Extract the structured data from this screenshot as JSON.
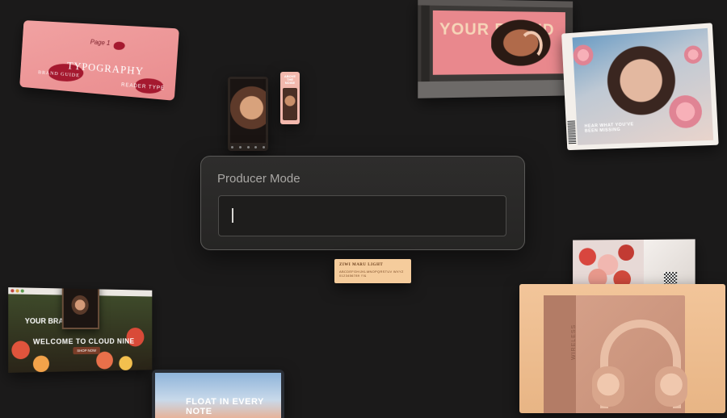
{
  "producer": {
    "title": "Producer Mode",
    "input_value": "",
    "input_placeholder": ""
  },
  "mockups": {
    "brand_guide": {
      "page_label": "Page 1",
      "typography": "TYPOGRAPHY",
      "brand_guide": "BRAND GUIDE",
      "reader": "READER TYPE"
    },
    "phone_small": {
      "text": "ABOVE THE NOISE"
    },
    "billboard": {
      "headline": "YOUR BRAND"
    },
    "magazine": {
      "caption": "HEAR WHAT YOU'VE BEEN MISSING"
    },
    "font_card": {
      "name": "ZIWI MARU LIGHT",
      "alphabet": "ABCDEFGHIJKLMNOPQRSTUV WXYZ 0123456789 !?&"
    },
    "website": {
      "brand": "YOUR BRAND",
      "headline": "WELCOME TO CLOUD NINE",
      "cta": "SHOP NOW"
    },
    "laptop": {
      "headline": "FLOAT IN EVERY NOTE"
    },
    "package": {
      "label": "WIRELESS"
    }
  },
  "colors": {
    "background": "#1b1a1a",
    "panel_border": "#5a5957",
    "accent_pink": "#e9888d",
    "accent_peach": "#f5cc9c"
  }
}
